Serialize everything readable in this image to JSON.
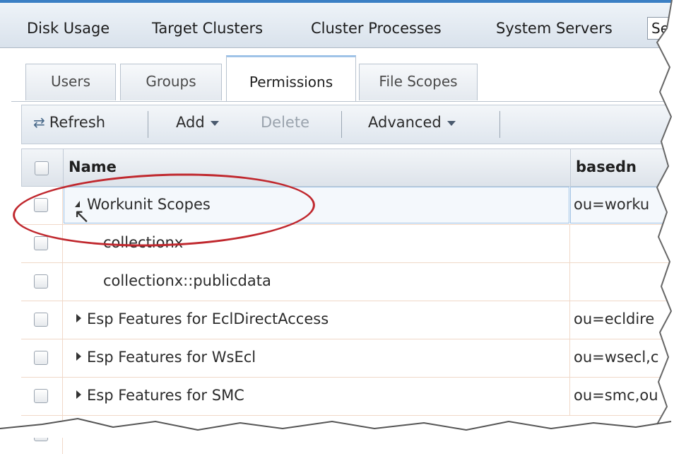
{
  "topbar": {
    "items": [
      "Disk Usage",
      "Target Clusters",
      "Cluster Processes",
      "System Servers"
    ],
    "search_value": "Se"
  },
  "tabs": [
    "Users",
    "Groups",
    "Permissions",
    "File Scopes"
  ],
  "active_tab": "Permissions",
  "toolbar": {
    "refresh_label": "Refresh",
    "add_label": "Add",
    "delete_label": "Delete",
    "advanced_label": "Advanced"
  },
  "grid": {
    "columns": [
      "Name",
      "basedn"
    ],
    "rows": [
      {
        "name": "Workunit Scopes",
        "basedn": "ou=worku",
        "toggle": "expanded"
      },
      {
        "name": "collectionx",
        "basedn": "",
        "toggle": "none"
      },
      {
        "name": "collectionx::publicdata",
        "basedn": "",
        "toggle": "none"
      },
      {
        "name": "Esp Features for EclDirectAccess",
        "basedn": "ou=ecldire",
        "toggle": "collapsed"
      },
      {
        "name": "Esp Features for WsEcl",
        "basedn": "ou=wsecl,c",
        "toggle": "collapsed"
      },
      {
        "name": "Esp Features for SMC",
        "basedn": "ou=smc,ou",
        "toggle": "collapsed"
      }
    ]
  },
  "colors": {
    "accent": "#3b7fc4",
    "annotation": "#c0282e",
    "row_border": "#f0d8c8"
  }
}
